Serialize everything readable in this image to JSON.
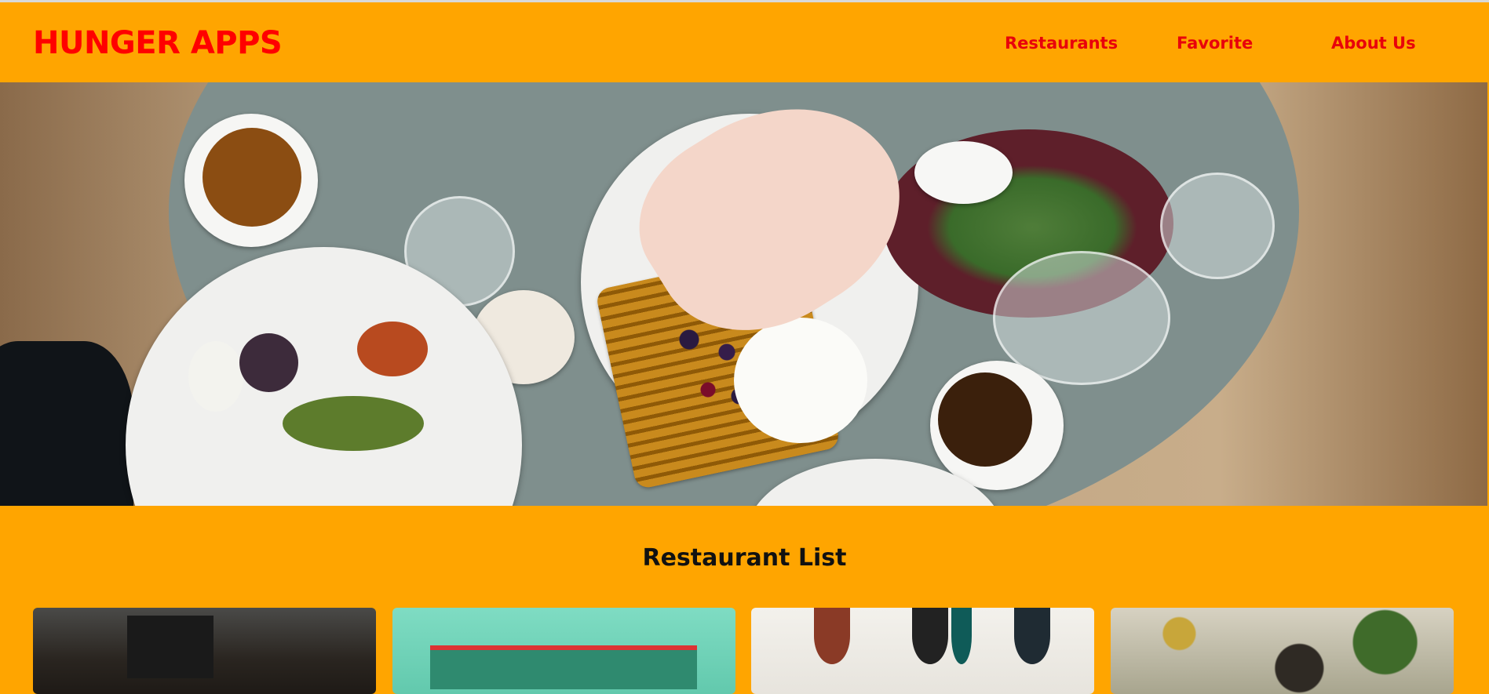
{
  "brand": "HUNGER APPS",
  "nav": {
    "restaurants": "Restaurants",
    "favorite": "Favorite",
    "about": "About Us"
  },
  "section_title": "Restaurant List",
  "colors": {
    "background": "#FFA500",
    "brand_text": "#FF0000",
    "nav_text": "#E8000B",
    "title_text": "#111111"
  },
  "restaurant_cards": [
    {
      "image": "restaurant-kitchen-image"
    },
    {
      "image": "restaurant-storefront-image"
    },
    {
      "image": "restaurant-lamps-image"
    },
    {
      "image": "restaurant-garden-image"
    }
  ]
}
